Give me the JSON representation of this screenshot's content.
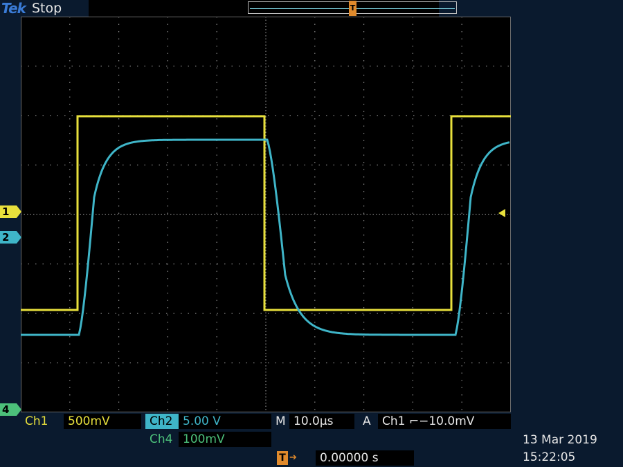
{
  "header": {
    "brand": "Tek",
    "run_status": "Stop"
  },
  "markers": {
    "ch1": "1",
    "ch2": "2",
    "ch4": "4",
    "trigger": "T"
  },
  "readout": {
    "ch1_label": "Ch1",
    "ch1_scale": "500mV",
    "ch2_label": "Ch2",
    "ch2_scale": "5.00 V",
    "ch4_label": "Ch4",
    "ch4_scale": "100mV",
    "timebase_label": "M",
    "timebase_value": "10.0µs",
    "trigger_label": "A",
    "trigger_value": "Ch1 ⌐−10.0mV",
    "trigger_position": "0.00000 s",
    "date": "13 Mar  2019",
    "time": "15:22:05"
  },
  "colors": {
    "ch1": "#e8e03c",
    "ch2": "#3fb5c8",
    "ch4": "#4cc07a",
    "trigger": "#e08a2c",
    "grid": "#8a8a8a",
    "screen": "#000000",
    "frame": "#0a1a2e"
  },
  "icons": {
    "trigger_marker": "trigger-t-icon",
    "trigger_arrow": "down-arrow-icon",
    "trigger_level": "left-arrow-icon",
    "trigger_position": "right-arrow-icon"
  }
}
